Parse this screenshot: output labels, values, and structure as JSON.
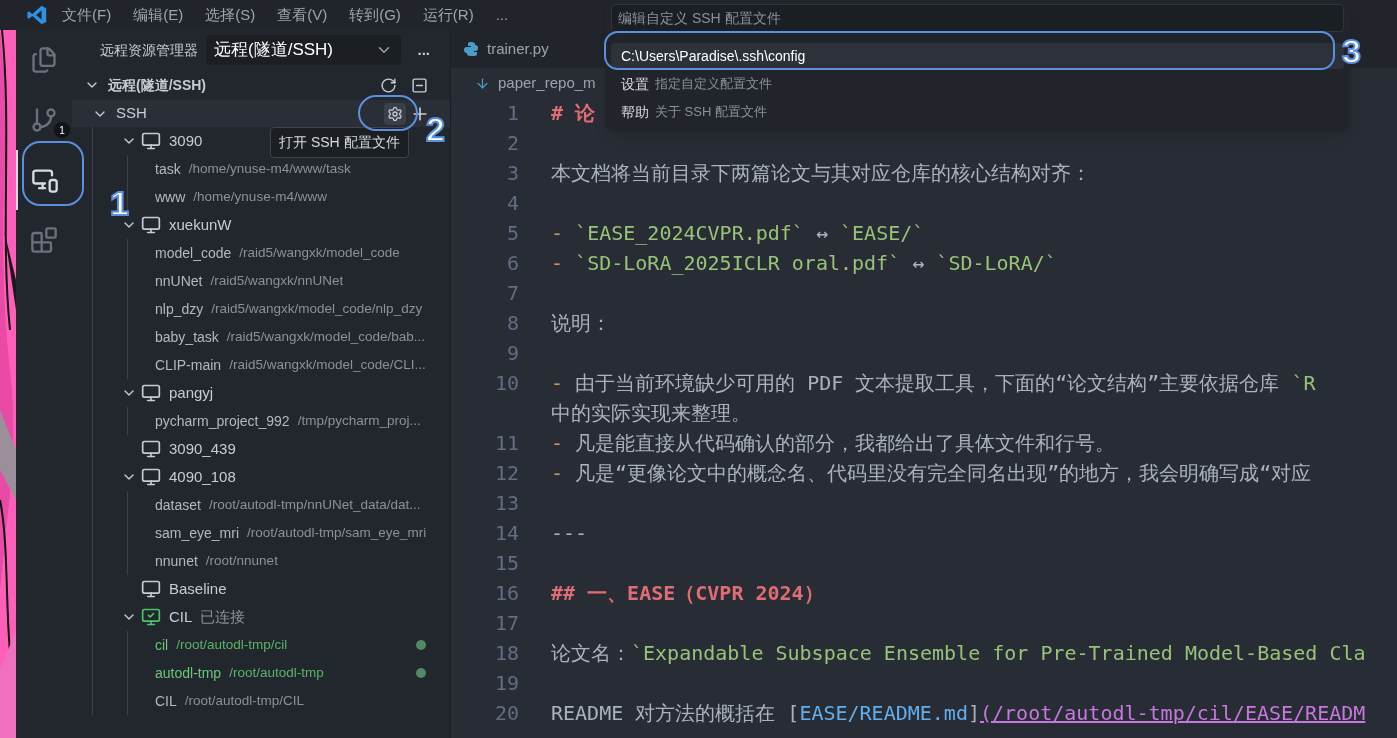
{
  "menu": [
    "文件(F)",
    "编辑(E)",
    "选择(S)",
    "查看(V)",
    "转到(G)",
    "运行(R)",
    "..."
  ],
  "activity_bar": [
    {
      "kind": "files",
      "selected": false
    },
    {
      "kind": "source-control",
      "selected": false,
      "badge": "1"
    },
    {
      "kind": "remote",
      "selected": true
    },
    {
      "kind": "extensions",
      "selected": false
    }
  ],
  "sidebar": {
    "title": "远程资源管理器",
    "dropdown": "远程(隧道/SSH)",
    "more": "...",
    "section": {
      "title": "远程(隧道/SSH)",
      "expanded": true
    },
    "group": {
      "name": "SSH",
      "expanded": true,
      "tooltip": "打开 SSH 配置文件"
    },
    "hosts": [
      {
        "name": "3090",
        "expanded": true,
        "connected": false,
        "children": [
          {
            "name": "task",
            "path": "/home/ynuse-m4/www/task",
            "open": false
          },
          {
            "name": "www",
            "path": "/home/ynuse-m4/www",
            "open": false
          }
        ]
      },
      {
        "name": "xuekunW",
        "expanded": true,
        "connected": false,
        "children": [
          {
            "name": "model_code",
            "path": "/raid5/wangxk/model_code",
            "open": false
          },
          {
            "name": "nnUNet",
            "path": "/raid5/wangxk/nnUNet",
            "open": false
          },
          {
            "name": "nlp_dzy",
            "path": "/raid5/wangxk/model_code/nlp_dzy",
            "open": false
          },
          {
            "name": "baby_task",
            "path": "/raid5/wangxk/model_code/bab...",
            "open": false
          },
          {
            "name": "CLIP-main",
            "path": "/raid5/wangxk/model_code/CLI...",
            "open": false
          }
        ]
      },
      {
        "name": "pangyj",
        "expanded": true,
        "connected": false,
        "children": [
          {
            "name": "pycharm_project_992",
            "path": "/tmp/pycharm_proj...",
            "open": false
          }
        ]
      },
      {
        "name": "3090_439",
        "connected": false
      },
      {
        "name": "4090_108",
        "expanded": true,
        "connected": false,
        "children": [
          {
            "name": "dataset",
            "path": "/root/autodl-tmp/nnUNet_data/dat...",
            "open": false
          },
          {
            "name": "sam_eye_mri",
            "path": "/root/autodl-tmp/sam_eye_mri",
            "open": false
          },
          {
            "name": "nnunet",
            "path": "/root/nnunet",
            "open": false
          }
        ]
      },
      {
        "name": "Baseline",
        "connected": false
      },
      {
        "name": "CIL",
        "expanded": true,
        "connected": true,
        "status": "已连接",
        "children": [
          {
            "name": "cil",
            "path": "/root/autodl-tmp/cil",
            "open": true
          },
          {
            "name": "autodl-tmp",
            "path": "/root/autodl-tmp",
            "open": true
          },
          {
            "name": "CIL",
            "path": "/root/autodl-tmp/CIL",
            "open": false
          }
        ]
      }
    ]
  },
  "editor": {
    "tab": "trainer.py",
    "breadcrumb": "paper_repo_m",
    "lines": [
      {
        "number": "1",
        "segments": [
          {
            "kind": "heading",
            "text": "# 论"
          }
        ]
      },
      {
        "number": "2"
      },
      {
        "number": "3",
        "segments": [
          {
            "kind": "plain",
            "text": "本文档将当前目录下两篇论文与其对应仓库的核心结构对齐："
          }
        ]
      },
      {
        "number": "4"
      },
      {
        "number": "5",
        "segments": [
          {
            "kind": "bullet",
            "text": "- "
          },
          {
            "kind": "code",
            "text": "`EASE_2024CVPR.pdf` "
          },
          {
            "kind": "plain",
            "text": "↔"
          },
          {
            "kind": "code",
            "text": " `EASE/`"
          }
        ]
      },
      {
        "number": "6",
        "segments": [
          {
            "kind": "bullet",
            "text": "- "
          },
          {
            "kind": "code",
            "text": "`SD-LoRA_2025ICLR oral.pdf` "
          },
          {
            "kind": "plain",
            "text": "↔"
          },
          {
            "kind": "code",
            "text": " `SD-LoRA/`"
          }
        ]
      },
      {
        "number": "7"
      },
      {
        "number": "8",
        "segments": [
          {
            "kind": "plain",
            "text": "说明："
          }
        ]
      },
      {
        "number": "9"
      },
      {
        "number": "10",
        "segments": [
          {
            "kind": "bullet",
            "text": "- "
          },
          {
            "kind": "plain",
            "text": "由于当前环境缺少可用的 PDF 文本提取工具，下面的“论文结构”主要依据仓库 "
          },
          {
            "kind": "code",
            "text": "`R"
          }
        ],
        "continuation": "中的实际实现来整理。"
      },
      {
        "number": "11",
        "segments": [
          {
            "kind": "bullet",
            "text": "- "
          },
          {
            "kind": "plain",
            "text": "凡是能直接从代码确认的部分，我都给出了具体文件和行号。"
          }
        ]
      },
      {
        "number": "12",
        "segments": [
          {
            "kind": "bullet",
            "text": "- "
          },
          {
            "kind": "plain",
            "text": "凡是“更像论文中的概念名、代码里没有完全同名出现”的地方，我会明确写成“对应"
          }
        ]
      },
      {
        "number": "13"
      },
      {
        "number": "14",
        "segments": [
          {
            "kind": "plain",
            "text": "---"
          }
        ]
      },
      {
        "number": "15"
      },
      {
        "number": "16",
        "segments": [
          {
            "kind": "heading",
            "text": "## 一、EASE（CVPR 2024）"
          }
        ]
      },
      {
        "number": "17"
      },
      {
        "number": "18",
        "segments": [
          {
            "kind": "plain",
            "text": "论文名："
          },
          {
            "kind": "code",
            "text": "`Expandable Subspace Ensemble for Pre-Trained Model-Based Cla"
          }
        ]
      },
      {
        "number": "19"
      },
      {
        "number": "20",
        "segments": [
          {
            "kind": "plain",
            "text": "README 对方法的概括在 ["
          },
          {
            "kind": "link",
            "text": "EASE/README.md"
          },
          {
            "kind": "plain",
            "text": "]"
          },
          {
            "kind": "url",
            "text": "(/root/autodl-tmp/cil/EASE/READM"
          }
        ]
      }
    ]
  },
  "palette": {
    "placeholder": "编辑自定义 SSH 配置文件",
    "items": [
      {
        "label": "C:\\Users\\Paradise\\.ssh\\config",
        "selected": true
      },
      {
        "label": "设置",
        "detail": "指定自定义配置文件",
        "selected": false
      },
      {
        "label": "帮助",
        "detail": "关于 SSH 配置文件",
        "selected": false
      }
    ]
  },
  "annotations": [
    "1",
    "2",
    "3"
  ]
}
